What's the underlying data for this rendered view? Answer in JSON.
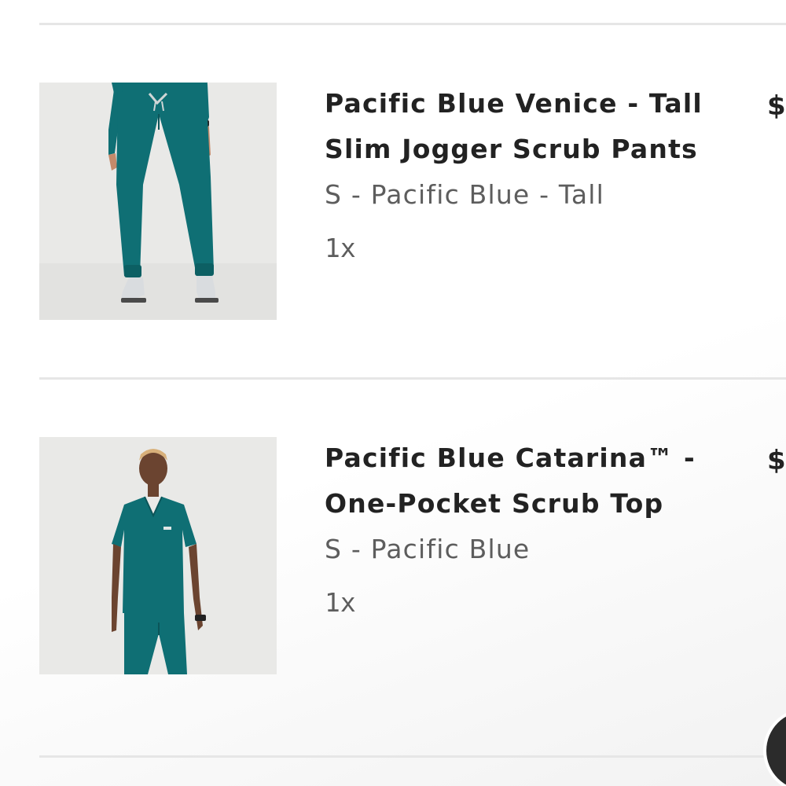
{
  "cart": {
    "items": [
      {
        "title_line1": "Pacific Blue Venice - Tall",
        "title_line2": "Slim Jogger Scrub Pants",
        "variant": "S - Pacific Blue - Tall",
        "quantity": "1x",
        "price": "$",
        "image_icon": "product-image-pants"
      },
      {
        "title_line1": "Pacific Blue Catarina™ -",
        "title_line2": "One-Pocket Scrub Top",
        "variant": "S - Pacific Blue",
        "quantity": "1x",
        "price": "$",
        "image_icon": "product-image-top"
      }
    ]
  },
  "colors": {
    "scrub_teal": "#0f6f74",
    "text_dark": "#222222",
    "text_muted": "#5d5d5d",
    "divider": "#e6e6e6"
  }
}
